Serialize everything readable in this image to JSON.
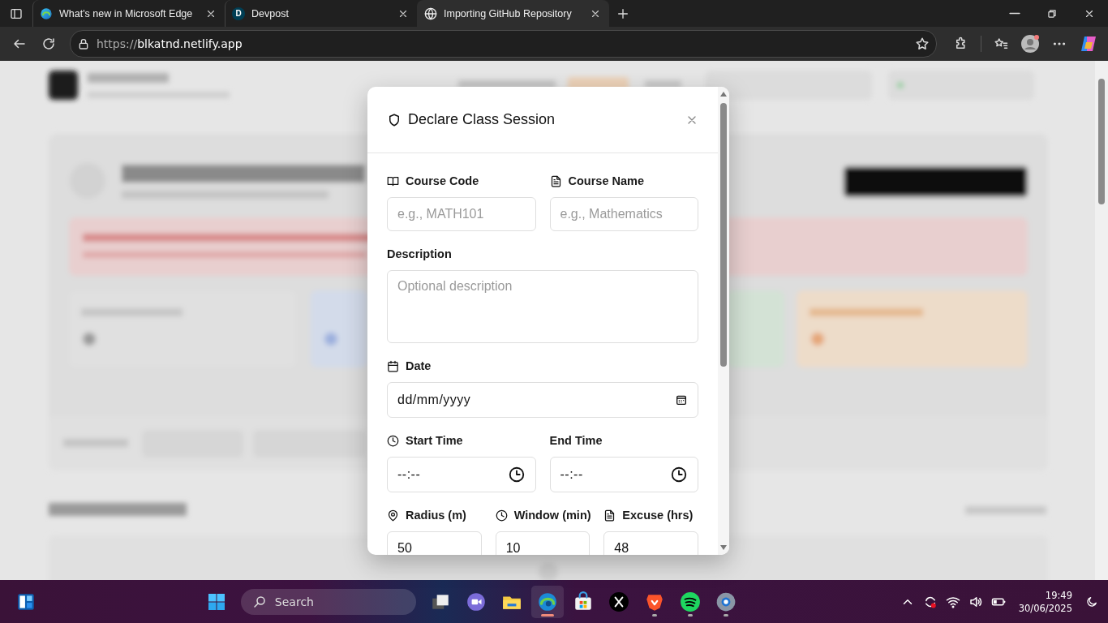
{
  "browser": {
    "tabs": [
      {
        "title": "What's new in Microsoft Edge",
        "selected": false
      },
      {
        "title": "Devpost",
        "letter": "D",
        "selected": false
      },
      {
        "title": "Importing GitHub Repository",
        "selected": true
      }
    ],
    "url": {
      "scheme": "https://",
      "host": "blkatnd.netlify.app"
    }
  },
  "modal": {
    "title": "Declare Class Session",
    "rows": [
      [
        {
          "kind": "text",
          "label": "Course Code",
          "placeholder": "e.g., MATH101"
        },
        {
          "kind": "text",
          "label": "Course Name",
          "placeholder": "e.g., Mathematics"
        }
      ],
      [
        {
          "kind": "textarea",
          "label": "Description",
          "placeholder": "Optional description"
        }
      ],
      [
        {
          "kind": "date",
          "label": "Date",
          "value": "dd/mm/yyyy"
        }
      ],
      [
        {
          "kind": "time",
          "label": "Start Time",
          "value": "--:--"
        },
        {
          "kind": "time",
          "label": "End Time",
          "value": "--:--"
        }
      ],
      [
        {
          "kind": "text",
          "label": "Radius (m)",
          "value": "50"
        },
        {
          "kind": "text",
          "label": "Window (min)",
          "value": "10"
        },
        {
          "kind": "text",
          "label": "Excuse (hrs)",
          "value": "48"
        }
      ]
    ]
  },
  "taskbar": {
    "search": "Search",
    "apps": [
      {
        "kind": "taskview",
        "running": false,
        "selected": false
      },
      {
        "kind": "meet",
        "running": false,
        "selected": false
      },
      {
        "kind": "folder",
        "running": false,
        "selected": false
      },
      {
        "kind": "edge",
        "running": true,
        "selected": true
      },
      {
        "kind": "store",
        "running": false,
        "selected": false
      },
      {
        "kind": "x",
        "running": false,
        "selected": false
      },
      {
        "kind": "brave",
        "running": true,
        "selected": false
      },
      {
        "kind": "spotify",
        "running": true,
        "selected": false
      },
      {
        "kind": "settings",
        "running": true,
        "selected": false
      }
    ],
    "time": "19:49",
    "date": "30/06/2025"
  }
}
